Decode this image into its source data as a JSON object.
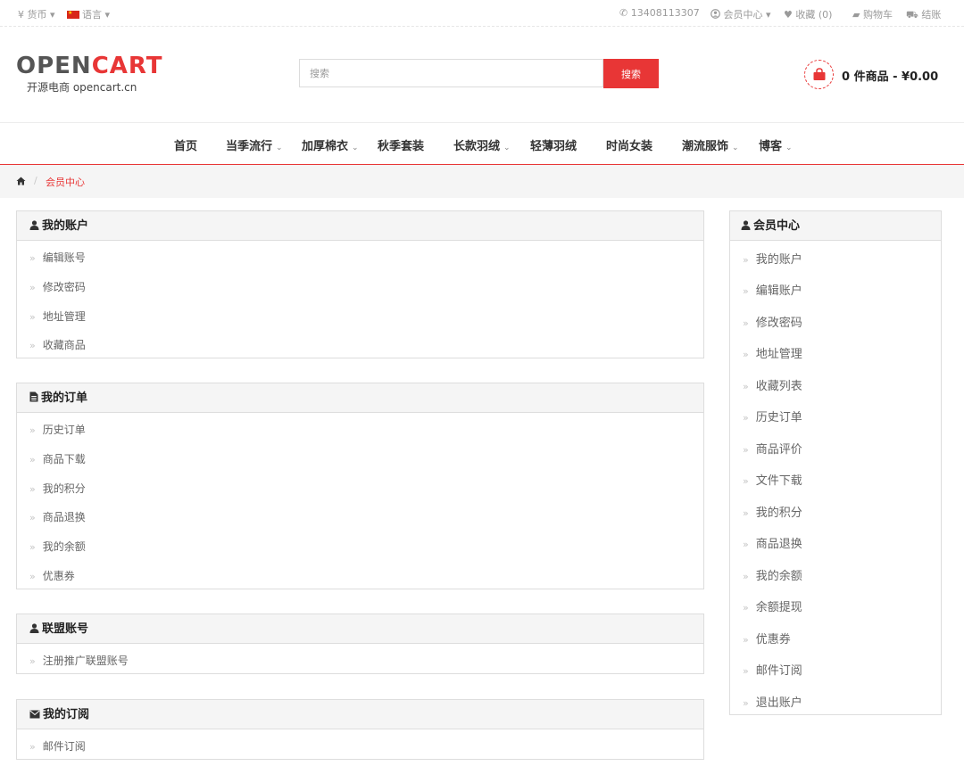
{
  "topbar": {
    "currency": "¥ 货币",
    "language": "语言",
    "phone": "13408113307",
    "account": "会员中心",
    "wishlist": "收藏 (0)",
    "cart": "购物车",
    "checkout": "结账"
  },
  "logo": {
    "open": "OPEN",
    "cart": "CART",
    "subtitle": "开源电商 opencart.cn"
  },
  "search": {
    "placeholder": "搜索",
    "button": "搜索"
  },
  "header_cart": {
    "text": "0 件商品 - ¥0.00"
  },
  "nav": {
    "items": [
      {
        "label": "首页",
        "dropdown": false
      },
      {
        "label": "当季流行",
        "dropdown": true
      },
      {
        "label": "加厚棉衣",
        "dropdown": true
      },
      {
        "label": "秋季套装",
        "dropdown": false
      },
      {
        "label": "长款羽绒",
        "dropdown": true
      },
      {
        "label": "轻薄羽绒",
        "dropdown": false
      },
      {
        "label": "时尚女装",
        "dropdown": false
      },
      {
        "label": "潮流服饰",
        "dropdown": true
      },
      {
        "label": "博客",
        "dropdown": true
      }
    ]
  },
  "breadcrumb": {
    "current": "会员中心"
  },
  "panels": {
    "account": {
      "title": "我的账户",
      "links": [
        "编辑账号",
        "修改密码",
        "地址管理",
        "收藏商品"
      ]
    },
    "orders": {
      "title": "我的订单",
      "links": [
        "历史订单",
        "商品下载",
        "我的积分",
        "商品退换",
        "我的余额",
        "优惠券"
      ]
    },
    "affiliate": {
      "title": "联盟账号",
      "links": [
        "注册推广联盟账号"
      ]
    },
    "newsletter": {
      "title": "我的订阅",
      "links": [
        "邮件订阅"
      ]
    }
  },
  "sidebar": {
    "title": "会员中心",
    "links": [
      "我的账户",
      "编辑账户",
      "修改密码",
      "地址管理",
      "收藏列表",
      "历史订单",
      "商品评价",
      "文件下载",
      "我的积分",
      "商品退换",
      "我的余额",
      "余额提现",
      "优惠券",
      "邮件订阅",
      "退出账户"
    ]
  },
  "colors": {
    "accent": "#e83636",
    "panel_header_bg": "#f5f5f5",
    "border": "#dddddd"
  }
}
